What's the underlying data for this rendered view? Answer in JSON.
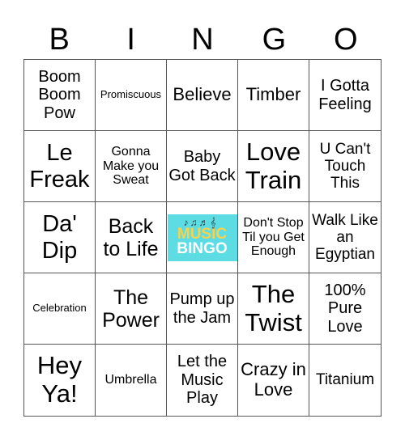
{
  "header": [
    "B",
    "I",
    "N",
    "G",
    "O"
  ],
  "free_space": {
    "line1": "MUSIC",
    "line2": "BINGO",
    "notes": "♪♫♬𝄞"
  },
  "cells": [
    "Boom Boom Pow",
    "Promiscuous",
    "Believe",
    "Timber",
    "I Gotta Feeling",
    "Le Freak",
    "Gonna Make you Sweat",
    "Baby Got Back",
    "Love Train",
    "U Can't Touch This",
    "Da' Dip",
    "Back to Life",
    "",
    "Don't Stop Til you Get Enough",
    "Walk Like an Egyptian",
    "Celebration",
    "The Power",
    "Pump up the Jam",
    "The Twist",
    "100% Pure Love",
    "Hey Ya!",
    "Umbrella",
    "Let the Music Play",
    "Crazy in Love",
    "Titanium"
  ]
}
